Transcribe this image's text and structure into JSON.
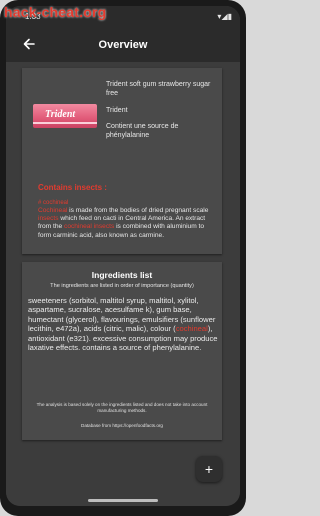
{
  "watermark": "hack-cheat.org",
  "status": {
    "time": "1:33",
    "indicators": "▾◢▮"
  },
  "app_bar": {
    "title": "Overview",
    "back_icon": "arrow-left-icon"
  },
  "product": {
    "name": "Trident soft gum strawberry sugar free",
    "brand": "Trident",
    "note": "Contient une source de phénylalanine",
    "image_label": "Trident"
  },
  "additives": {
    "heading": "Contains insects :",
    "tag": "# cochineal",
    "desc_parts": [
      {
        "text": "Cochineal",
        "highlight": true
      },
      {
        "text": " is made from the bodies of dried pregnant scale ",
        "highlight": false
      },
      {
        "text": "insects",
        "highlight": true
      },
      {
        "text": " which feed on cacti in Central America. An extract from the ",
        "highlight": false
      },
      {
        "text": "cochineal insects",
        "highlight": true
      },
      {
        "text": " is combined with aluminium to form carminic acid, also known as carmine.",
        "highlight": false
      }
    ]
  },
  "ingredients": {
    "title": "Ingredients list",
    "subtitle": "The ingredients are listed in order of importance (quantity)",
    "text_before": "sweeteners (sorbitol, maltitol syrup, maltitol, xylitol, aspartame, sucralose, acesulfame k), gum base, humectant (glycerol), flavourings, emulsifiers (sunflower lecithin, e472a), acids (citric, malic), colour (",
    "text_highlight": "cochineal",
    "text_after": "), antioxidant (e321). excessive consumption may produce laxative effects. contains a source of phenylalanine.",
    "disclaimer": "The analysis is based solely on the ingredients listed and does not take into account manufacturing methods.",
    "source": "Database from https://openfoodfacts.org"
  },
  "fab": {
    "label": "+",
    "icon": "plus-icon"
  },
  "colors": {
    "accent": "#e23b2f",
    "card": "#4a4a4a",
    "background": "#3c3c3c",
    "appbar": "#2b2b2b"
  }
}
